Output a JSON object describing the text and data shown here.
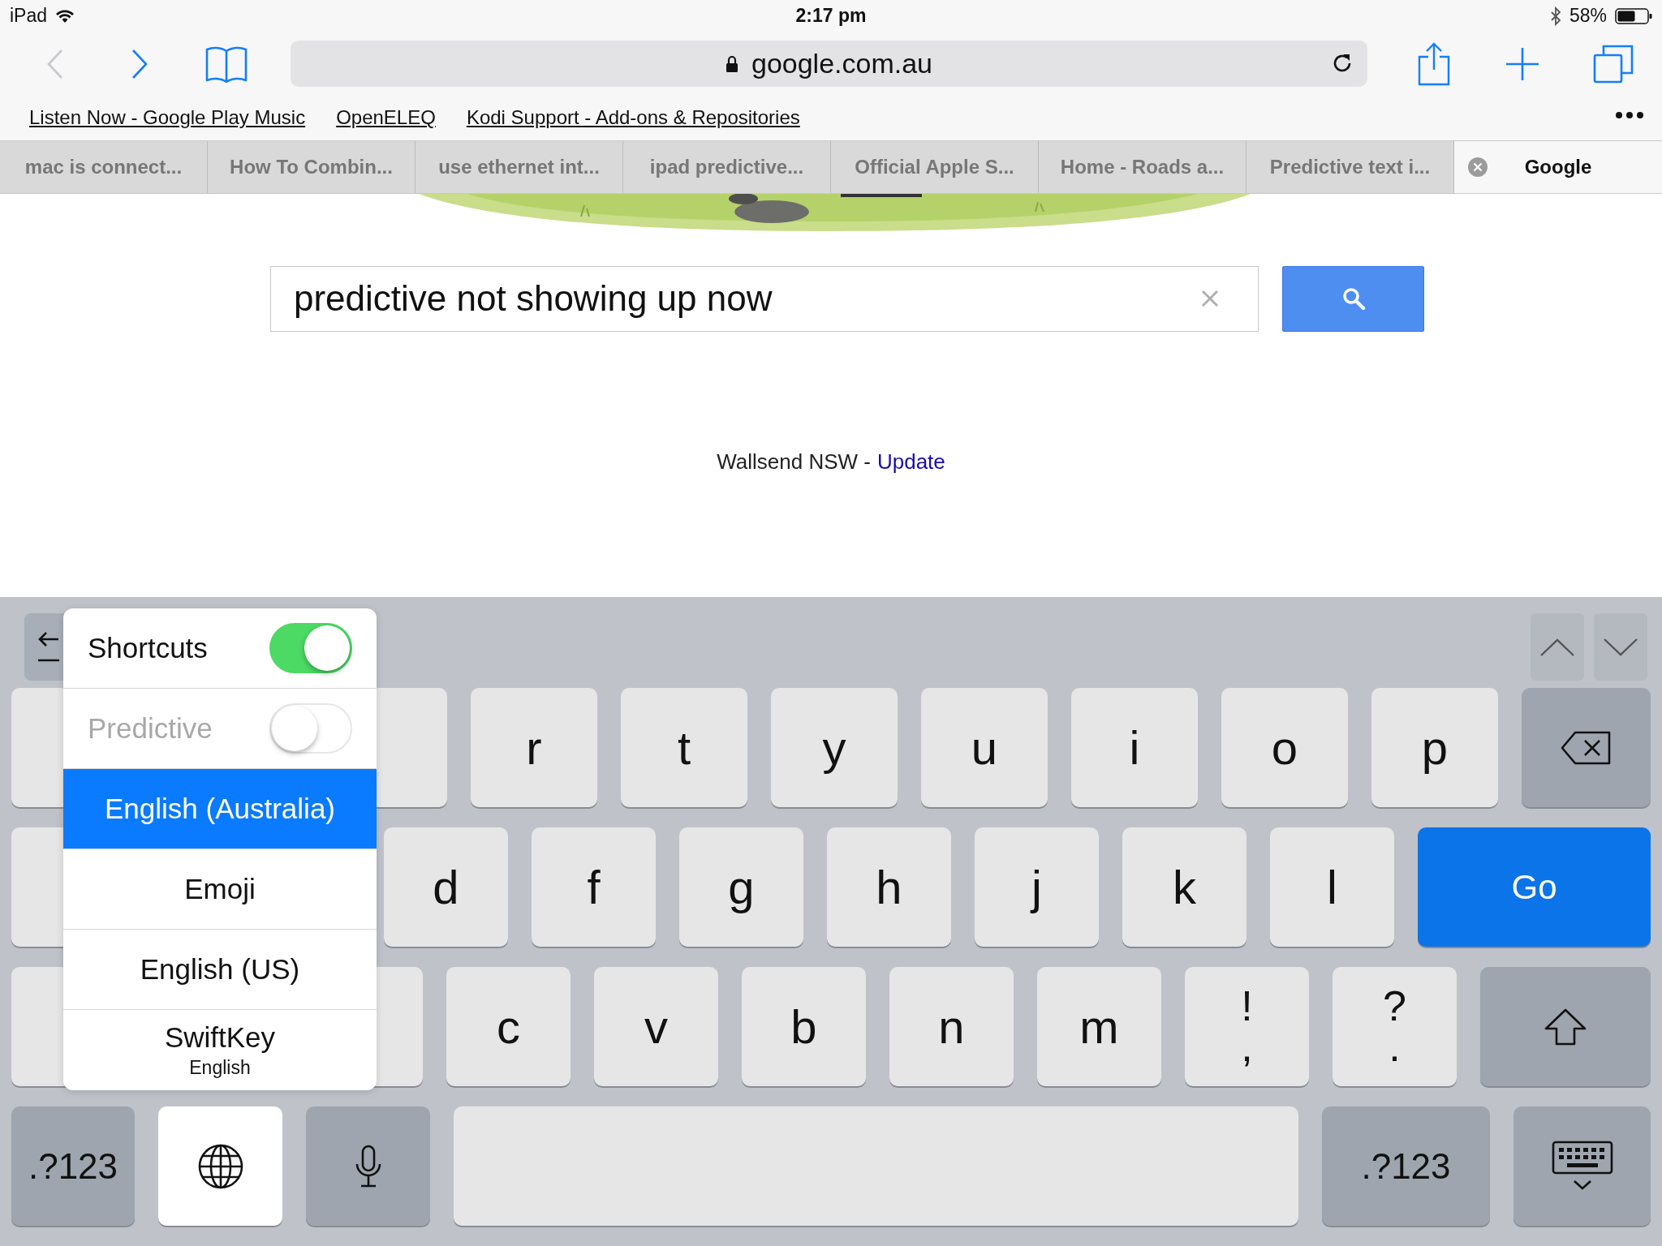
{
  "status_bar": {
    "device": "iPad",
    "time": "2:17 pm",
    "battery": "58%"
  },
  "toolbar": {
    "back": {
      "disabled": true
    },
    "forward": {
      "disabled": false
    },
    "url": "google.com.au"
  },
  "bookmarks": [
    "Listen Now - Google Play Music",
    "OpenELEQ",
    "Kodi Support - Add-ons & Repositories"
  ],
  "tabs": [
    {
      "title": "mac is connect...",
      "selected": false
    },
    {
      "title": "How To Combin...",
      "selected": false
    },
    {
      "title": "use ethernet int...",
      "selected": false
    },
    {
      "title": "ipad predictive...",
      "selected": false
    },
    {
      "title": "Official Apple S...",
      "selected": false
    },
    {
      "title": "Home - Roads a...",
      "selected": false
    },
    {
      "title": "Predictive text i...",
      "selected": false
    },
    {
      "title": "Google",
      "selected": true
    }
  ],
  "page": {
    "search": {
      "value": "predictive not showing up now"
    },
    "location": {
      "text": "Wallsend NSW -",
      "link": "Update"
    }
  },
  "keyboard": {
    "rows": [
      {
        "keys": [
          {
            "kind": "blank"
          },
          {
            "kind": "letter",
            "label": "r"
          },
          {
            "kind": "letter",
            "label": "t"
          },
          {
            "kind": "letter",
            "label": "y"
          },
          {
            "kind": "letter",
            "label": "u"
          },
          {
            "kind": "letter",
            "label": "i"
          },
          {
            "kind": "letter",
            "label": "o"
          },
          {
            "kind": "letter",
            "label": "p"
          },
          {
            "kind": "delete"
          }
        ]
      },
      {
        "keys": [
          {
            "kind": "blank"
          },
          {
            "kind": "letter",
            "label": "d"
          },
          {
            "kind": "letter",
            "label": "f"
          },
          {
            "kind": "letter",
            "label": "g"
          },
          {
            "kind": "letter",
            "label": "h"
          },
          {
            "kind": "letter",
            "label": "j"
          },
          {
            "kind": "letter",
            "label": "k"
          },
          {
            "kind": "letter",
            "label": "l"
          },
          {
            "kind": "go",
            "label": "Go"
          }
        ]
      },
      {
        "keys": [
          {
            "kind": "blank"
          },
          {
            "kind": "letter",
            "label": "c"
          },
          {
            "kind": "letter",
            "label": "v"
          },
          {
            "kind": "letter",
            "label": "b"
          },
          {
            "kind": "letter",
            "label": "n"
          },
          {
            "kind": "letter",
            "label": "m"
          },
          {
            "kind": "letter",
            "label": "!",
            "sub": ","
          },
          {
            "kind": "letter",
            "label": "?",
            "sub": "."
          },
          {
            "kind": "shift"
          }
        ]
      },
      {
        "keys": [
          {
            "kind": "mode",
            "label": ".?123"
          },
          {
            "kind": "globe",
            "selected": true
          },
          {
            "kind": "mic"
          },
          {
            "kind": "space"
          },
          {
            "kind": "mode",
            "label": ".?123"
          },
          {
            "kind": "hide"
          }
        ]
      }
    ],
    "menu": {
      "items": [
        {
          "kind": "toggle",
          "label": "Shortcuts",
          "on": true,
          "disabled": false
        },
        {
          "kind": "toggle",
          "label": "Predictive",
          "on": false,
          "disabled": true
        },
        {
          "kind": "language",
          "label": "English (Australia)",
          "selected": true
        },
        {
          "kind": "language",
          "label": "Emoji",
          "selected": false
        },
        {
          "kind": "language",
          "label": "English (US)",
          "selected": false
        },
        {
          "kind": "language",
          "label": "SwiftKey",
          "sub": "English",
          "selected": false
        }
      ]
    }
  }
}
